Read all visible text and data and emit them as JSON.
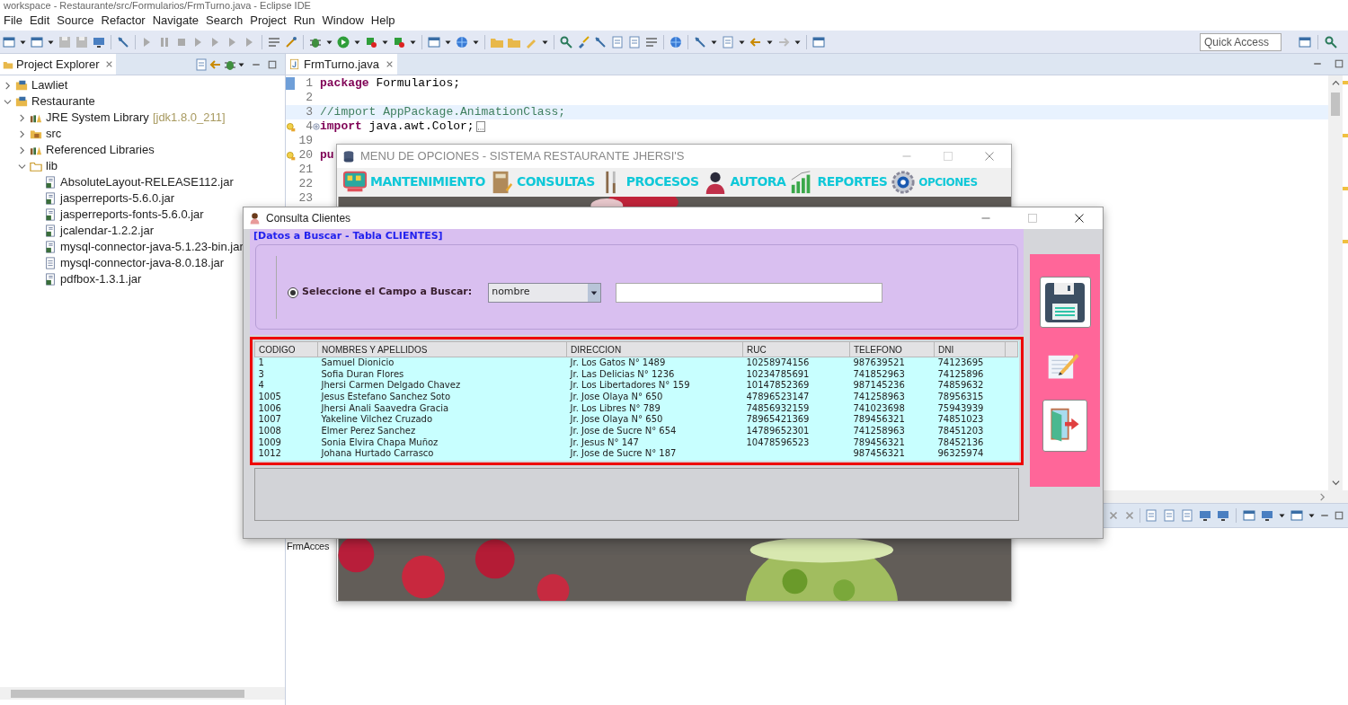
{
  "window": {
    "title": "workspace - Restaurante/src/Formularios/FrmTurno.java - Eclipse IDE"
  },
  "menu_bar": [
    "File",
    "Edit",
    "Source",
    "Refactor",
    "Navigate",
    "Search",
    "Project",
    "Run",
    "Window",
    "Help"
  ],
  "quick_access": {
    "placeholder": "Quick Access"
  },
  "project_explorer": {
    "title": "Project Explorer",
    "tree": [
      {
        "label": "Lawliet",
        "kind": "project",
        "expanded": false
      },
      {
        "label": "Restaurante",
        "kind": "project",
        "expanded": true,
        "children": [
          {
            "label": "JRE System Library",
            "detail": "[jdk1.8.0_211]",
            "kind": "library",
            "expanded": false
          },
          {
            "label": "src",
            "kind": "package_folder",
            "expanded": false
          },
          {
            "label": "Referenced Libraries",
            "kind": "library",
            "expanded": false
          },
          {
            "label": "lib",
            "kind": "folder",
            "expanded": true,
            "children": [
              {
                "label": "AbsoluteLayout-RELEASE112.jar",
                "kind": "jar"
              },
              {
                "label": "jasperreports-5.6.0.jar",
                "kind": "jar"
              },
              {
                "label": "jasperreports-fonts-5.6.0.jar",
                "kind": "jar"
              },
              {
                "label": "jcalendar-1.2.2.jar",
                "kind": "jar"
              },
              {
                "label": "mysql-connector-java-5.1.23-bin.jar",
                "kind": "jar"
              },
              {
                "label": "mysql-connector-java-8.0.18.jar",
                "kind": "file"
              },
              {
                "label": "pdfbox-1.3.1.jar",
                "kind": "jar"
              }
            ]
          }
        ]
      }
    ]
  },
  "editor": {
    "tab": "FrmTurno.java",
    "lines": [
      {
        "number": "1",
        "highlighted": false,
        "warning": false,
        "folded": false,
        "tokens": [
          {
            "text": "package",
            "kind": "keyword"
          },
          {
            "text": " Formularios;",
            "kind": "plain"
          }
        ]
      },
      {
        "number": "2",
        "highlighted": false,
        "warning": false,
        "folded": false
      },
      {
        "number": "3",
        "highlighted": true,
        "warning": false,
        "folded": false,
        "tokens": [
          {
            "text": "//import AppPackage.AnimationClass;",
            "kind": "comment"
          }
        ]
      },
      {
        "number": "4",
        "highlighted": false,
        "warning": true,
        "folded": true,
        "tokens": [
          {
            "text": "import",
            "kind": "keyword"
          },
          {
            "text": " java.awt.Color;",
            "kind": "plain"
          }
        ]
      },
      {
        "number": "19",
        "highlighted": false,
        "warning": false,
        "folded": false
      },
      {
        "number": "20",
        "highlighted": false,
        "warning": true,
        "folded": false,
        "tokens": [
          {
            "text": "pu",
            "kind": "keyword"
          }
        ]
      },
      {
        "number": "21",
        "highlighted": false,
        "warning": false,
        "folded": false
      },
      {
        "number": "22",
        "highlighted": false,
        "warning": false,
        "folded": false
      },
      {
        "number": "23",
        "highlighted": false,
        "warning": false,
        "folded": false
      }
    ]
  },
  "bottom_panel": {
    "text": "FrmAcces"
  },
  "menu_window": {
    "title": "MENU DE OPCIONES - SISTEMA RESTAURANTE JHERSI'S",
    "menus": [
      {
        "label": "MANTENIMIENTO",
        "kind": "monitor"
      },
      {
        "label": "CONSULTAS",
        "kind": "notebook"
      },
      {
        "label": "PROCESOS",
        "kind": "cutlery"
      },
      {
        "label": "AUTORA",
        "kind": "person"
      },
      {
        "label": "REPORTES",
        "kind": "chart"
      },
      {
        "label": "OPCIONES",
        "kind": "gear"
      }
    ]
  },
  "dialog": {
    "title": "Consulta Clientes",
    "group_title": "[Datos a Buscar - Tabla CLIENTES]",
    "radio": {
      "label": "Seleccione el Campo a Buscar:",
      "selected": true
    },
    "field_combo": {
      "value": "nombre"
    },
    "table": {
      "columns": [
        "CODIGO",
        "NOMBRES Y APELLIDOS",
        "DIRECCION",
        "RUC",
        "TELEFONO",
        "DNI"
      ],
      "rows": [
        [
          "1",
          "Samuel Dionicio",
          "Jr. Los Gatos N° 1489",
          "10258974156",
          "987639521",
          "74123695"
        ],
        [
          "3",
          "Sofia Duran Flores",
          "Jr. Las Delicias N° 1236",
          "10234785691",
          "741852963",
          "74125896"
        ],
        [
          "4",
          "Jhersi Carmen Delgado Chavez",
          "Jr. Los Libertadores N° 159",
          "10147852369",
          "987145236",
          "74859632"
        ],
        [
          "1005",
          "Jesus Estefano Sanchez Soto",
          "Jr. Jose Olaya N° 650",
          "47896523147",
          "741258963",
          "78956315"
        ],
        [
          "1006",
          "Jhersi Anali Saavedra Gracia",
          "Jr. Los Libres N° 789",
          "74856932159",
          "741023698",
          "75943939"
        ],
        [
          "1007",
          "Yakeline Vilchez Cruzado",
          "Jr. Jose Olaya N° 650",
          "78965421369",
          "789456321",
          "74851023"
        ],
        [
          "1008",
          "Elmer Perez Sanchez",
          "Jr. Jose de Sucre N° 654",
          "14789652301",
          "741258963",
          "78451203"
        ],
        [
          "1009",
          "Sonia Elvira Chapa Muñoz",
          "Jr. Jesus N° 147",
          "10478596523",
          "789456321",
          "78452136"
        ],
        [
          "1012",
          "Johana Hurtado Carrasco",
          "Jr. Jose de Sucre N° 187",
          null,
          "987456321",
          "96325974"
        ]
      ]
    },
    "side_buttons": [
      {
        "kind": "save"
      },
      {
        "kind": "edit"
      },
      {
        "kind": "exit"
      }
    ]
  }
}
